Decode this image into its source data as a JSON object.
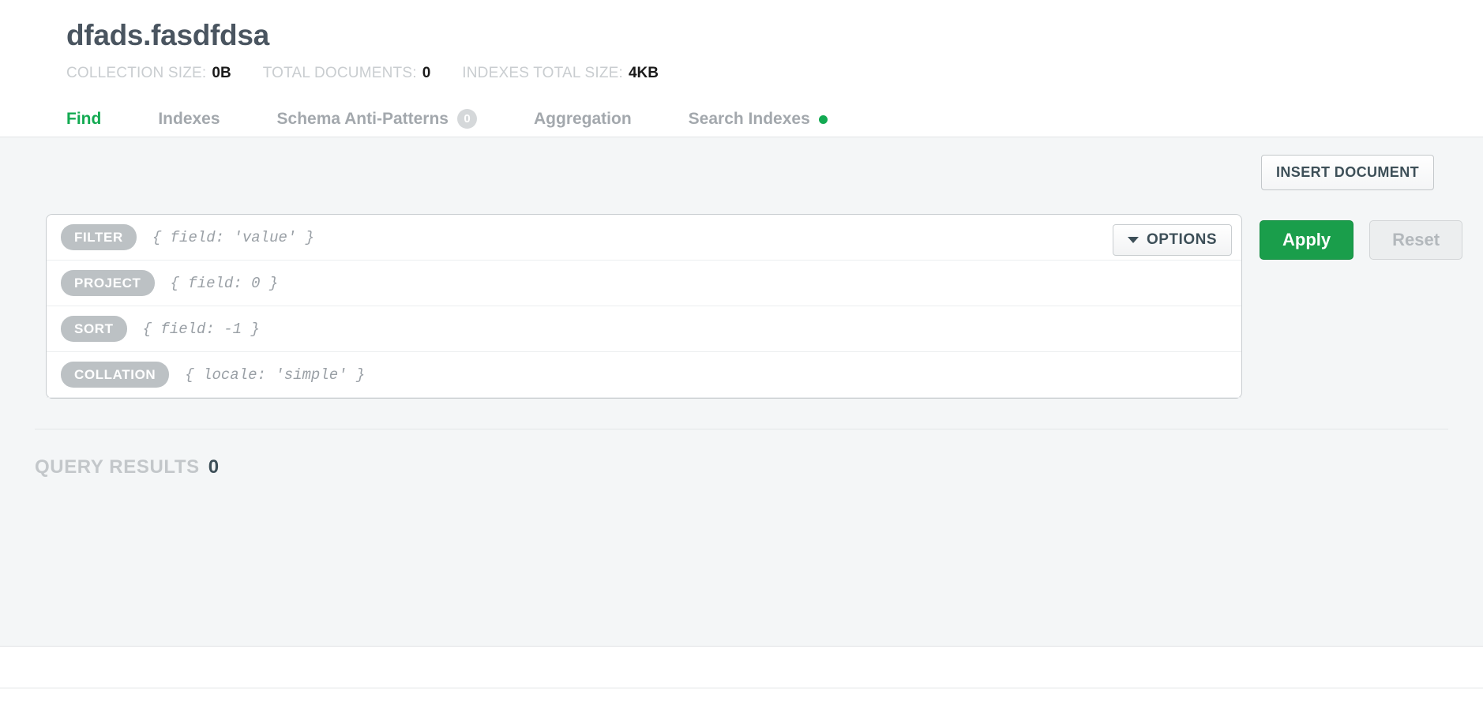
{
  "header": {
    "title": "dfads.fasdfdsa",
    "stats": [
      {
        "label": "COLLECTION SIZE:",
        "value": "0B"
      },
      {
        "label": "TOTAL DOCUMENTS:",
        "value": "0"
      },
      {
        "label": "INDEXES TOTAL SIZE:",
        "value": "4KB"
      }
    ]
  },
  "tabs": [
    {
      "label": "Find",
      "active": true
    },
    {
      "label": "Indexes",
      "active": false
    },
    {
      "label": "Schema Anti-Patterns",
      "badge": "0",
      "active": false
    },
    {
      "label": "Aggregation",
      "active": false
    },
    {
      "label": "Search Indexes",
      "dot": true,
      "active": false
    }
  ],
  "toolbar": {
    "insert_document_label": "INSERT DOCUMENT"
  },
  "query": {
    "rows": [
      {
        "pill": "FILTER",
        "placeholder": "{ field: 'value' }",
        "value": ""
      },
      {
        "pill": "PROJECT",
        "placeholder": "{ field: 0 }",
        "value": ""
      },
      {
        "pill": "SORT",
        "placeholder": "{ field: -1 }",
        "value": ""
      },
      {
        "pill": "COLLATION",
        "placeholder": "{ locale: 'simple' }",
        "value": ""
      }
    ],
    "options_label": "OPTIONS",
    "apply_label": "Apply",
    "reset_label": "Reset"
  },
  "results": {
    "label": "QUERY RESULTS",
    "count": "0"
  },
  "colors": {
    "accent_green": "#13aa52",
    "apply_green": "#1a9e4b",
    "muted_gray": "#c9cdd0",
    "title_gray": "#4a5560",
    "panel_bg": "#f4f6f7"
  }
}
